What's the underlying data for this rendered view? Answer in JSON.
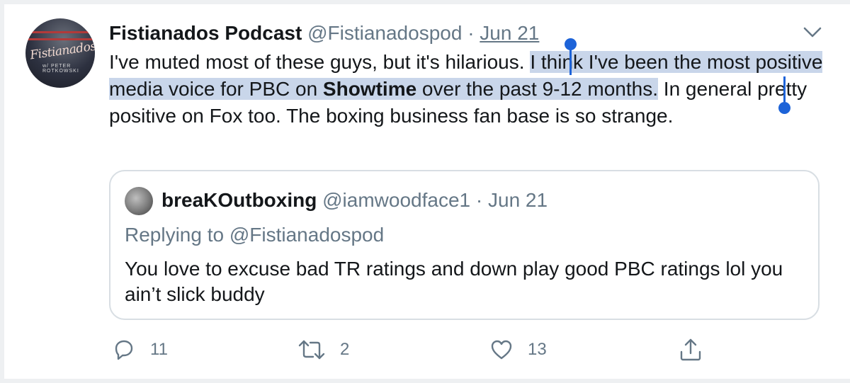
{
  "tweet": {
    "author_name": "Fistianados Podcast",
    "author_handle": "@Fistianadospod",
    "separator": "·",
    "date": "Jun 21",
    "avatar_logo_text": "Fistianados",
    "avatar_sub_text": "w/ PETER ROTKOWSKI",
    "text_part1": "I've muted most of these guys, but it's hilarious.",
    "text_sel1": "I think I've been the most positive media voice for PBC on ",
    "text_sel_bold": "Showtime",
    "text_sel2": " over the past 9-12 months.",
    "text_part2": " In general pretty positive on Fox too. The boxing business fan base is so strange."
  },
  "quoted_tweet": {
    "author_name": "breaKOutboxing",
    "author_handle": "@iamwoodface1",
    "separator": "·",
    "date": "Jun 21",
    "replying_to": "Replying to @Fistianadospod",
    "text": "You love to excuse bad TR ratings and down play good PBC ratings lol you ain’t slick buddy"
  },
  "actions": {
    "reply_count": "11",
    "retweet_count": "2",
    "like_count": "13"
  },
  "icons": {
    "menu": "chevron-down-icon",
    "reply": "reply-icon",
    "retweet": "retweet-icon",
    "like": "heart-icon",
    "share": "share-icon"
  },
  "colors": {
    "selection": "#c9d6ea",
    "selection_handle": "#1d63d8",
    "muted_text": "#657786"
  }
}
